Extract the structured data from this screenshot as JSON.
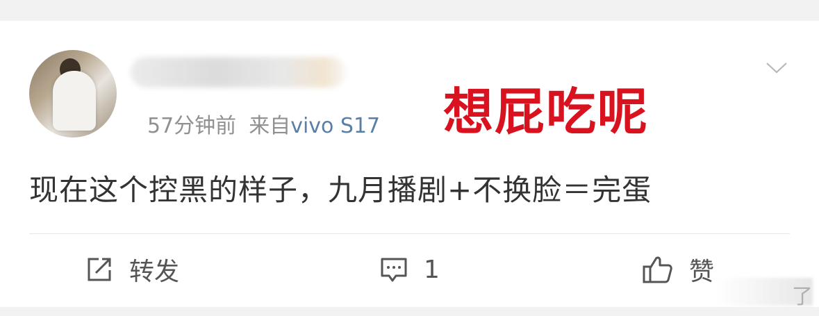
{
  "post": {
    "time": "57分钟前",
    "source_prefix": "来自",
    "device": "vivo S17",
    "overlay_text": "想屁吃呢",
    "content": "现在这个控黑的样子，九月播剧+不换脸＝完蛋"
  },
  "actions": {
    "repost_label": "转发",
    "comment_count": "1",
    "like_label": "赞"
  },
  "watermark": {
    "char": "了"
  },
  "colors": {
    "accent_red": "#d9121f",
    "device_link": "#5b7ea6",
    "meta_gray": "#909090",
    "text": "#333333"
  }
}
